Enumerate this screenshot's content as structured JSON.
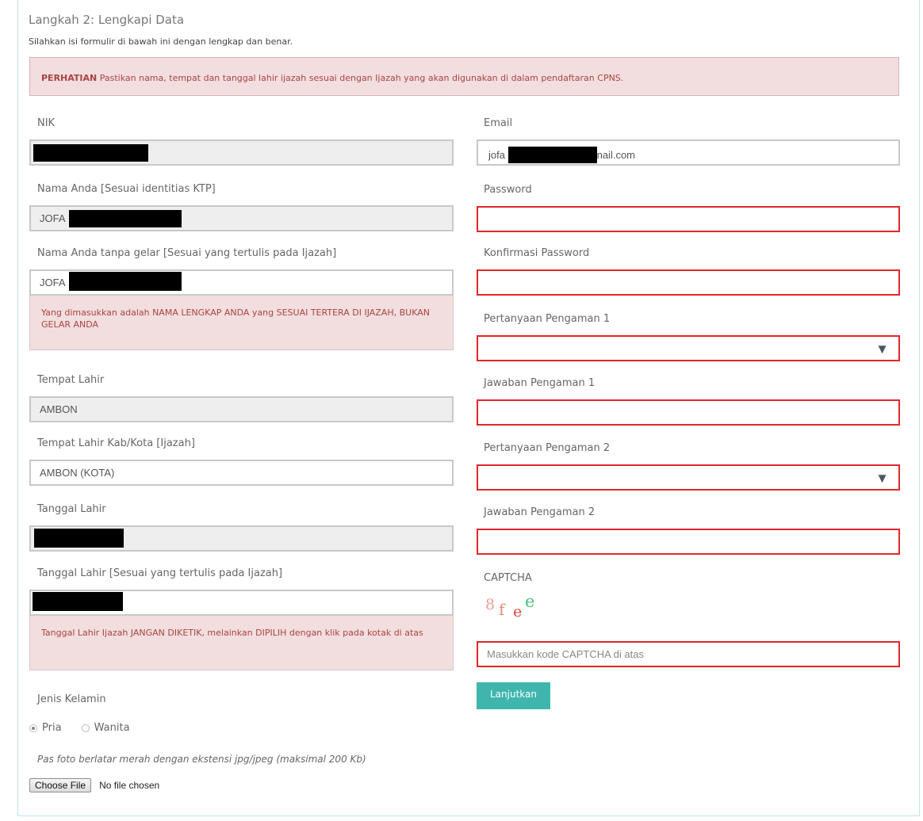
{
  "header": {
    "title": "Langkah 2: Lengkapi Data",
    "subtitle": "Silahkan isi formulir di bawah ini dengan lengkap dan benar."
  },
  "alert": {
    "strong": "PERHATIAN",
    "text": " Pastikan nama, tempat dan tanggal lahir ijazah sesuai dengan Ijazah yang akan digunakan di dalam pendaftaran CPNS."
  },
  "left": {
    "nik": {
      "label": "NIK",
      "value": ""
    },
    "nama": {
      "label": "Nama Anda [Sesuai identitias KTP]",
      "value": "JOFA"
    },
    "nama_ijazah": {
      "label": "Nama Anda tanpa gelar [Sesuai yang tertulis pada Ijazah]",
      "value": "JOFA",
      "hint": "Yang dimasukkan adalah NAMA LENGKAP ANDA yang SESUAI TERTERA DI IJAZAH, BUKAN GELAR ANDA"
    },
    "tempat_lahir": {
      "label": "Tempat Lahir",
      "value": "AMBON"
    },
    "tempat_lahir_ijazah": {
      "label": "Tempat Lahir Kab/Kota [Ijazah]",
      "value": "AMBON (KOTA)"
    },
    "tanggal_lahir": {
      "label": "Tanggal Lahir",
      "value": ""
    },
    "tanggal_lahir_ijazah": {
      "label": "Tanggal Lahir [Sesuai yang tertulis pada Ijazah]",
      "value": "",
      "hint": "Tanggal Lahir Ijazah JANGAN DIKETIK, melainkan DIPILIH dengan klik pada kotak di atas"
    },
    "gender": {
      "label": "Jenis Kelamin",
      "option1": "Pria",
      "option2": "Wanita",
      "selected": "Pria"
    },
    "photo": {
      "note": "Pas foto berlatar merah dengan ekstensi jpg/jpeg (maksimal 200 Kb)",
      "button": "Choose File",
      "status": "No file chosen"
    }
  },
  "right": {
    "email": {
      "label": "Email",
      "prefix": "jofa",
      "suffix": "nail.com"
    },
    "password": {
      "label": "Password",
      "value": ""
    },
    "password_confirm": {
      "label": "Konfirmasi Password",
      "value": ""
    },
    "question1": {
      "label": "Pertanyaan Pengaman 1",
      "value": ""
    },
    "answer1": {
      "label": "Jawaban Pengaman 1",
      "value": ""
    },
    "question2": {
      "label": "Pertanyaan Pengaman 2",
      "value": ""
    },
    "answer2": {
      "label": "Jawaban Pengaman 2",
      "value": ""
    },
    "captcha": {
      "label": "CAPTCHA",
      "chars": [
        "8",
        "f",
        "e",
        "e"
      ],
      "colors": [
        "#e9a09a",
        "#e58a72",
        "#d9483d",
        "#4fbf7d"
      ],
      "placeholder": "Masukkan kode CAPTCHA di atas"
    },
    "submit": "Lanjutkan"
  },
  "icons": {
    "select_arrow": "▼"
  },
  "colors": {
    "error_border": "#e3262a",
    "alert_bg": "#f2dede",
    "alert_text": "#a94442",
    "button": "#3fb6ad"
  }
}
